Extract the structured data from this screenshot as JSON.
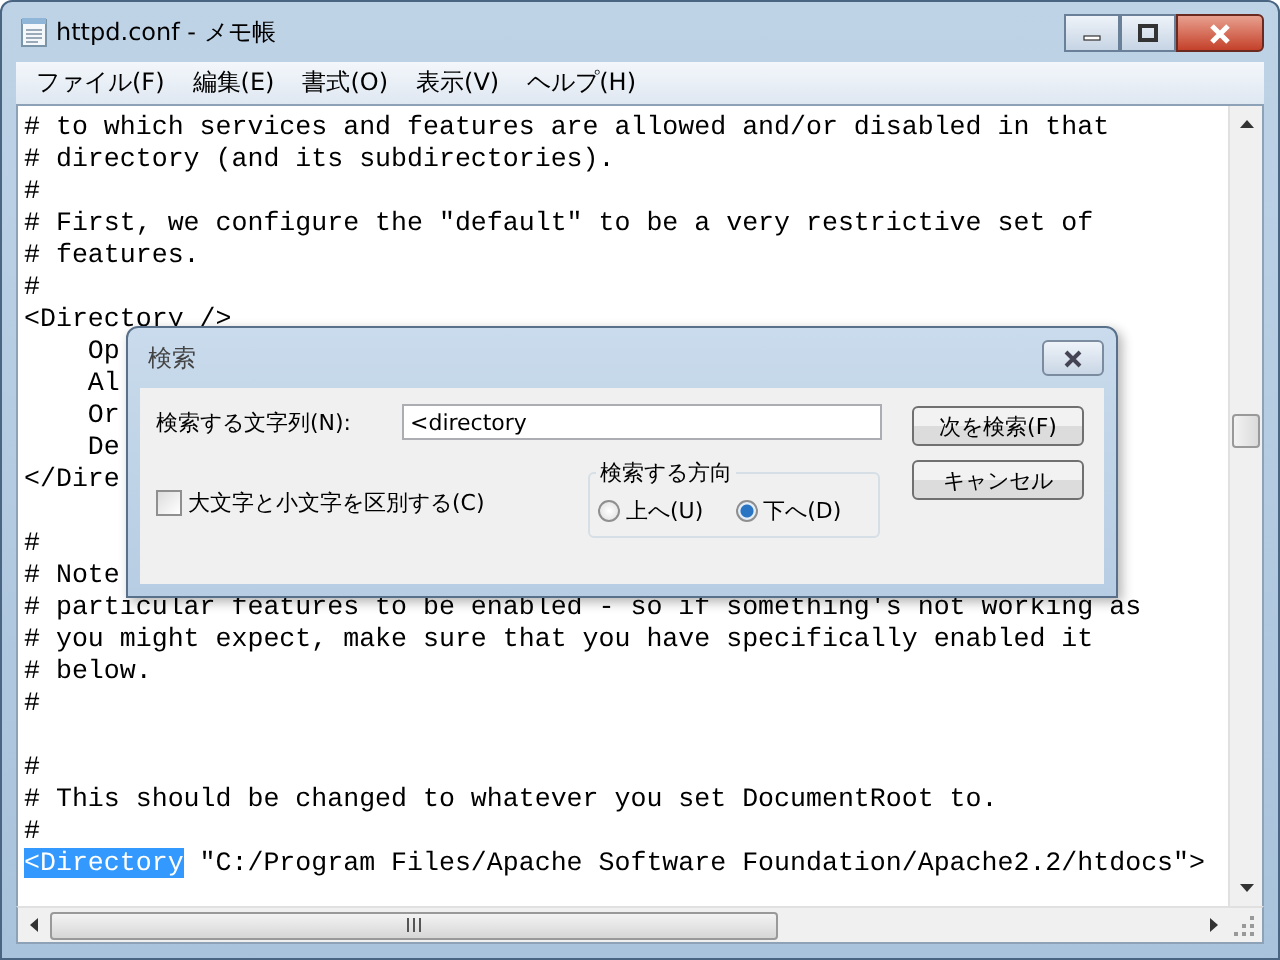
{
  "window": {
    "title": "httpd.conf - メモ帳"
  },
  "menu": [
    "ファイル(F)",
    "編集(E)",
    "書式(O)",
    "表示(V)",
    "ヘルプ(H)"
  ],
  "editor": {
    "lines": [
      {
        "kind": "text",
        "text": "# to which services and features are allowed and/or disabled in that"
      },
      {
        "kind": "text",
        "text": "# directory (and its subdirectories)."
      },
      {
        "kind": "text",
        "text": "#"
      },
      {
        "kind": "text",
        "text": "# First, we configure the \"default\" to be a very restrictive set of"
      },
      {
        "kind": "text",
        "text": "# features."
      },
      {
        "kind": "text",
        "text": "#"
      },
      {
        "kind": "text",
        "text": "<Directory />"
      },
      {
        "kind": "text",
        "text": "    Op"
      },
      {
        "kind": "text",
        "text": "    Al"
      },
      {
        "kind": "text",
        "text": "    Or"
      },
      {
        "kind": "text",
        "text": "    De"
      },
      {
        "kind": "text",
        "text": "</Dire"
      },
      {
        "kind": "blank"
      },
      {
        "kind": "text",
        "text": "#"
      },
      {
        "kind": "text",
        "text": "# Note"
      },
      {
        "kind": "text",
        "text": "# particular features to be enabled - so if something's not working as"
      },
      {
        "kind": "text",
        "text": "# you might expect, make sure that you have specifically enabled it"
      },
      {
        "kind": "text",
        "text": "# below."
      },
      {
        "kind": "text",
        "text": "#"
      },
      {
        "kind": "blank"
      },
      {
        "kind": "text",
        "text": "#"
      },
      {
        "kind": "text",
        "text": "# This should be changed to whatever you set DocumentRoot to."
      },
      {
        "kind": "text",
        "text": "#"
      },
      {
        "kind": "selection",
        "selected": "<Directory",
        "text": " \"C:/Program Files/Apache Software Foundation/Apache2.2/htdocs\">"
      }
    ]
  },
  "find_dialog": {
    "title": "検索",
    "search_label": "検索する文字列(N):",
    "search_value": "<directory",
    "buttons": [
      "次を検索(F)",
      "キャンセル"
    ],
    "match_case": {
      "label": "大文字と小文字を区別する(C)",
      "checked": false
    },
    "direction": {
      "label": "検索する方向",
      "options": [
        {
          "label": "上へ(U)",
          "selected": false
        },
        {
          "label": "下へ(D)",
          "selected": true
        }
      ]
    }
  }
}
